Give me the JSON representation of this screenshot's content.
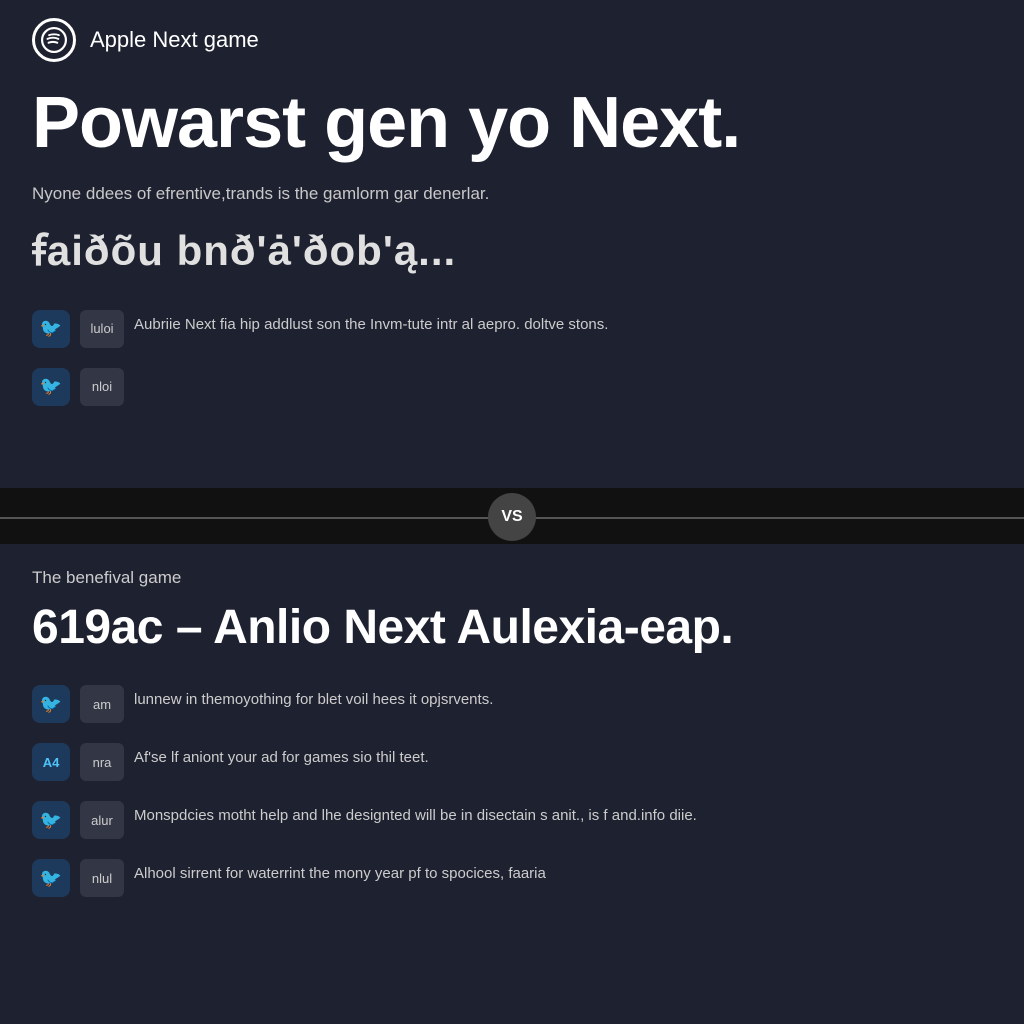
{
  "top": {
    "header": {
      "app_title": "Apple Next game"
    },
    "headline": "Powarst gen yo Next.",
    "subtitle": "Nyone ddees of efrentive,trands is the gamlorm gar denerlar.",
    "foreign_text": "ꞙaiðõu bnð'ȧ'ðob'ą...",
    "items": [
      {
        "icon": "twitter",
        "label": "luloi",
        "text": "Aubriie Next fia hip addlust son the Invm-tute intr al aepro. doltve stons."
      },
      {
        "icon": "twitter",
        "label": "nloi",
        "text": ""
      }
    ]
  },
  "vs": {
    "label": "VS"
  },
  "bottom": {
    "section_label": "The benefival game",
    "headline": "619ac – Anlio Next Aulexia-eap.",
    "items": [
      {
        "icon": "twitter",
        "label": "am",
        "text": "lunnew in themoyothing for blet voil hees it opjsrvents."
      },
      {
        "icon": "A4",
        "label": "nra",
        "text": "Af'se lf aniont your ad for games sio thil teet."
      },
      {
        "icon": "twitter",
        "label": "alur",
        "text": "Monspdcies motht help and lhe designted will be in disectain s anit., is f and.info diie."
      },
      {
        "icon": "twitter-small",
        "label": "nlul",
        "text": "Alhool sirrent for waterrint the mony year pf to spocices, faaria"
      }
    ]
  }
}
